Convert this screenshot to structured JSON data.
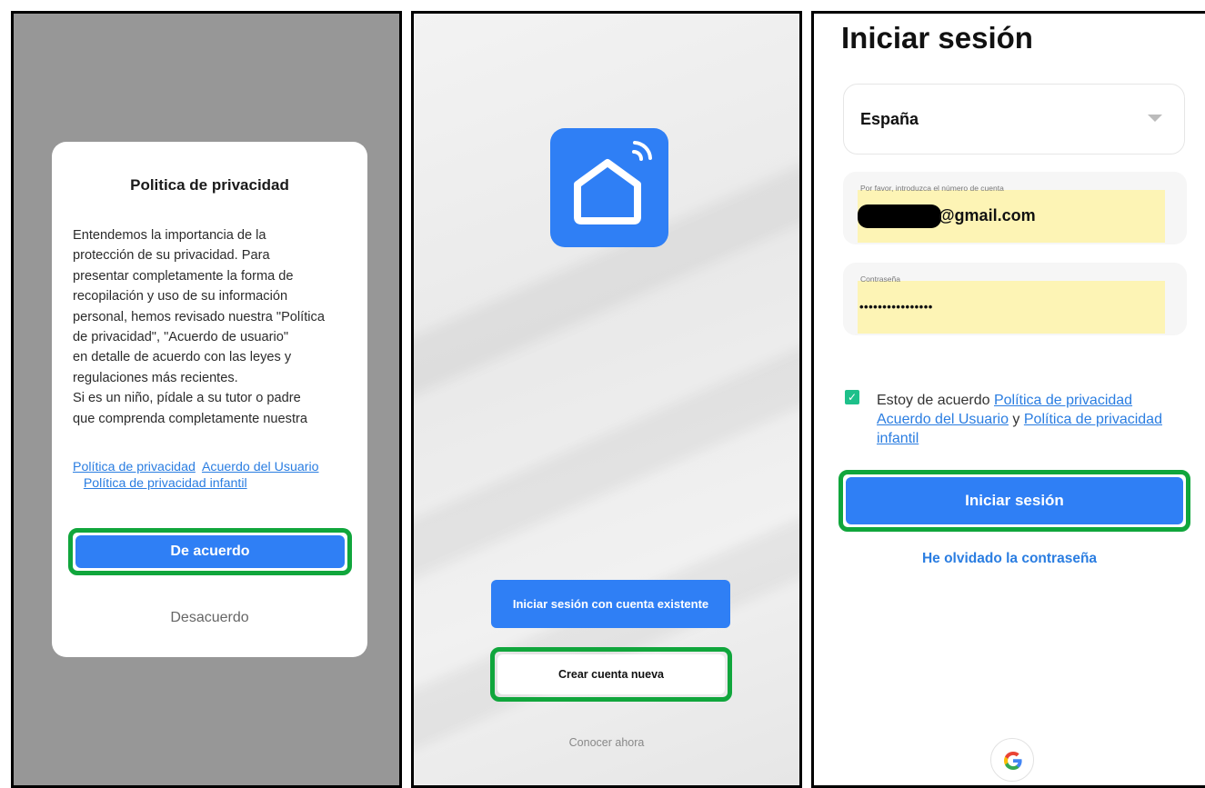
{
  "privacy_dialog": {
    "title": "Politica de privacidad",
    "body": "Entendemos la importancia de la\nprotección de su privacidad. Para\npresentar completamente la forma de\nrecopilación y uso de su información\npersonal, hemos revisado nuestra \"Política\nde privacidad\", \"Acuerdo de usuario\"\nen detalle de acuerdo con las leyes y\nregulaciones más recientes.\nSi es un niño, pídale a su tutor o padre\nque comprenda completamente nuestra",
    "link_privacy": "Política de privacidad",
    "link_user_agreement": "Acuerdo del Usuario",
    "link_child_privacy": "Política de privacidad infantil",
    "agree_label": "De acuerdo",
    "disagree_label": "Desacuerdo"
  },
  "welcome": {
    "login_existing_label": "Iniciar sesión con cuenta existente",
    "create_account_label": "Crear cuenta nueva",
    "learn_more_label": "Conocer ahora"
  },
  "login": {
    "title": "Iniciar sesión",
    "country": "España",
    "account_label": "Por favor, introduzca el número de cuenta",
    "account_value": "@gmail.com",
    "password_label": "Contraseña",
    "password_value": "••••••••••••••••",
    "agree_prefix": "Estoy de acuerdo",
    "agree_link_privacy": "Política de privacidad",
    "agree_link_user": "Acuerdo del Usuario",
    "agree_and": "y",
    "agree_link_child": "Política de privacidad infantil",
    "submit_label": "Iniciar sesión",
    "forgot_label": "He olvidado la contraseña"
  },
  "colors": {
    "accent_blue": "#2f7ff5",
    "highlight_green": "#10a63c",
    "link_blue": "#2a7de1",
    "check_green": "#1ec08a"
  }
}
